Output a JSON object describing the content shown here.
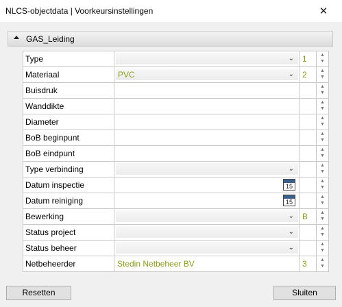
{
  "window": {
    "title": "NLCS-objectdata | Voorkeursinstellingen",
    "close_glyph": "✕"
  },
  "section": {
    "label": "GAS_Leiding",
    "collapsed": false
  },
  "rows": [
    {
      "label": "Type",
      "kind": "dropdown",
      "value": "",
      "code": "1"
    },
    {
      "label": "Materiaal",
      "kind": "dropdown",
      "value": "PVC",
      "code": "2"
    },
    {
      "label": "Buisdruk",
      "kind": "text",
      "value": "",
      "code": ""
    },
    {
      "label": "Wanddikte",
      "kind": "text",
      "value": "",
      "code": ""
    },
    {
      "label": "Diameter",
      "kind": "text",
      "value": "",
      "code": ""
    },
    {
      "label": "BoB beginpunt",
      "kind": "text",
      "value": "",
      "code": ""
    },
    {
      "label": "BoB eindpunt",
      "kind": "text",
      "value": "",
      "code": ""
    },
    {
      "label": "Type verbinding",
      "kind": "dropdown",
      "value": "",
      "code": ""
    },
    {
      "label": "Datum inspectie",
      "kind": "date",
      "value": "",
      "code": "",
      "calendar_day": "15"
    },
    {
      "label": "Datum reiniging",
      "kind": "date",
      "value": "",
      "code": "",
      "calendar_day": "15"
    },
    {
      "label": "Bewerking",
      "kind": "dropdown",
      "value": "",
      "code": "B"
    },
    {
      "label": "Status project",
      "kind": "dropdown",
      "value": "",
      "code": ""
    },
    {
      "label": "Status beheer",
      "kind": "dropdown",
      "value": "",
      "code": ""
    },
    {
      "label": "Netbeheerder",
      "kind": "text",
      "value": "Stedin Netbeheer BV",
      "code": "3"
    }
  ],
  "buttons": {
    "reset": "Resetten",
    "close": "Sluiten"
  },
  "colors": {
    "value_text": "#8a9a1f",
    "background": "#f0f0f0"
  }
}
